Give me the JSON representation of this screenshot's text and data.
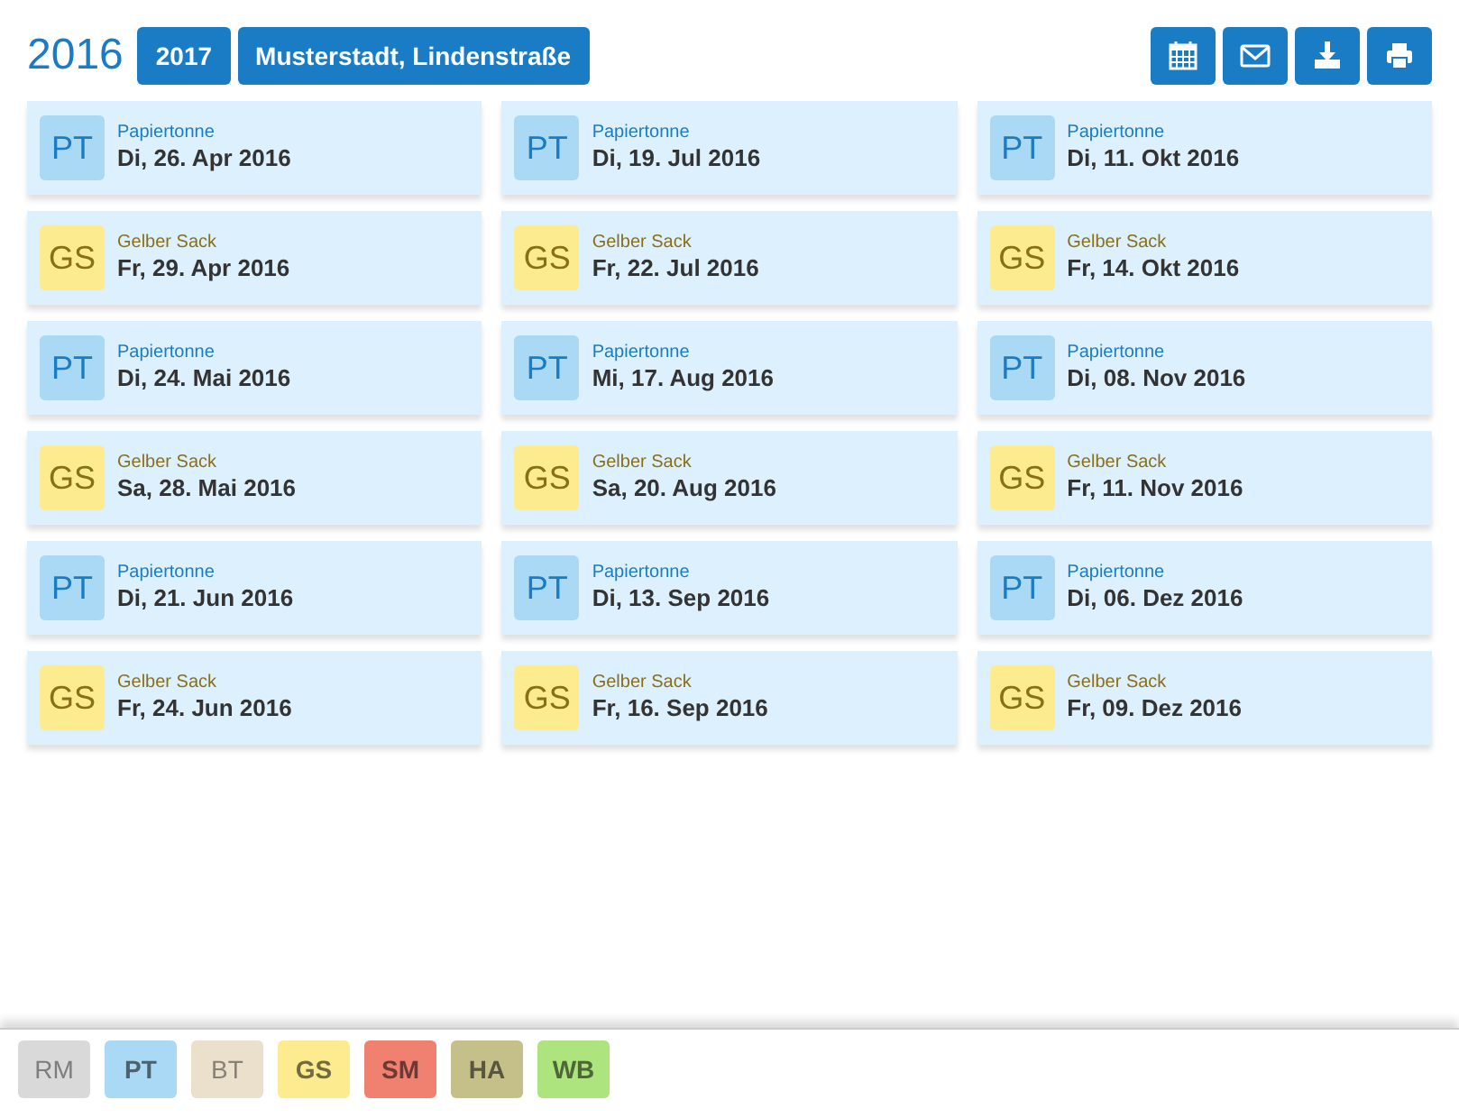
{
  "header": {
    "year": "2016",
    "next_year": "2017",
    "location": "Musterstadt, Lindenstraße"
  },
  "toolbar": [
    {
      "kind": "calendar"
    },
    {
      "kind": "mail"
    },
    {
      "kind": "download"
    },
    {
      "kind": "print"
    }
  ],
  "columns": [
    [
      {
        "kind": "PT",
        "code": "PT",
        "type": "Papiertonne",
        "date": "Di, 26. Apr 2016"
      },
      {
        "kind": "GS",
        "code": "GS",
        "type": "Gelber Sack",
        "date": "Fr, 29. Apr 2016"
      },
      {
        "kind": "PT",
        "code": "PT",
        "type": "Papiertonne",
        "date": "Di, 24. Mai 2016"
      },
      {
        "kind": "GS",
        "code": "GS",
        "type": "Gelber Sack",
        "date": "Sa, 28. Mai 2016"
      },
      {
        "kind": "PT",
        "code": "PT",
        "type": "Papiertonne",
        "date": "Di, 21. Jun 2016"
      },
      {
        "kind": "GS",
        "code": "GS",
        "type": "Gelber Sack",
        "date": "Fr, 24. Jun 2016"
      }
    ],
    [
      {
        "kind": "PT",
        "code": "PT",
        "type": "Papiertonne",
        "date": "Di, 19. Jul 2016"
      },
      {
        "kind": "GS",
        "code": "GS",
        "type": "Gelber Sack",
        "date": "Fr, 22. Jul 2016"
      },
      {
        "kind": "PT",
        "code": "PT",
        "type": "Papiertonne",
        "date": "Mi, 17. Aug 2016"
      },
      {
        "kind": "GS",
        "code": "GS",
        "type": "Gelber Sack",
        "date": "Sa, 20. Aug 2016"
      },
      {
        "kind": "PT",
        "code": "PT",
        "type": "Papiertonne",
        "date": "Di, 13. Sep 2016"
      },
      {
        "kind": "GS",
        "code": "GS",
        "type": "Gelber Sack",
        "date": "Fr, 16. Sep 2016"
      }
    ],
    [
      {
        "kind": "PT",
        "code": "PT",
        "type": "Papiertonne",
        "date": "Di, 11. Okt 2016"
      },
      {
        "kind": "GS",
        "code": "GS",
        "type": "Gelber Sack",
        "date": "Fr, 14. Okt 2016"
      },
      {
        "kind": "PT",
        "code": "PT",
        "type": "Papiertonne",
        "date": "Di, 08. Nov 2016"
      },
      {
        "kind": "GS",
        "code": "GS",
        "type": "Gelber Sack",
        "date": "Fr, 11. Nov 2016"
      },
      {
        "kind": "PT",
        "code": "PT",
        "type": "Papiertonne",
        "date": "Di, 06. Dez 2016"
      },
      {
        "kind": "GS",
        "code": "GS",
        "type": "Gelber Sack",
        "date": "Fr, 09. Dez 2016"
      }
    ]
  ],
  "filters": [
    {
      "label": "RM",
      "color": "#d9d9d9",
      "selected": false
    },
    {
      "label": "PT",
      "color": "#a9d9f5",
      "selected": true
    },
    {
      "label": "BT",
      "color": "#ebe0cc",
      "selected": false
    },
    {
      "label": "GS",
      "color": "#fdec8f",
      "selected": true
    },
    {
      "label": "SM",
      "color": "#f08070",
      "selected": true
    },
    {
      "label": "HA",
      "color": "#c5c08a",
      "selected": true
    },
    {
      "label": "WB",
      "color": "#aee47d",
      "selected": true
    }
  ]
}
